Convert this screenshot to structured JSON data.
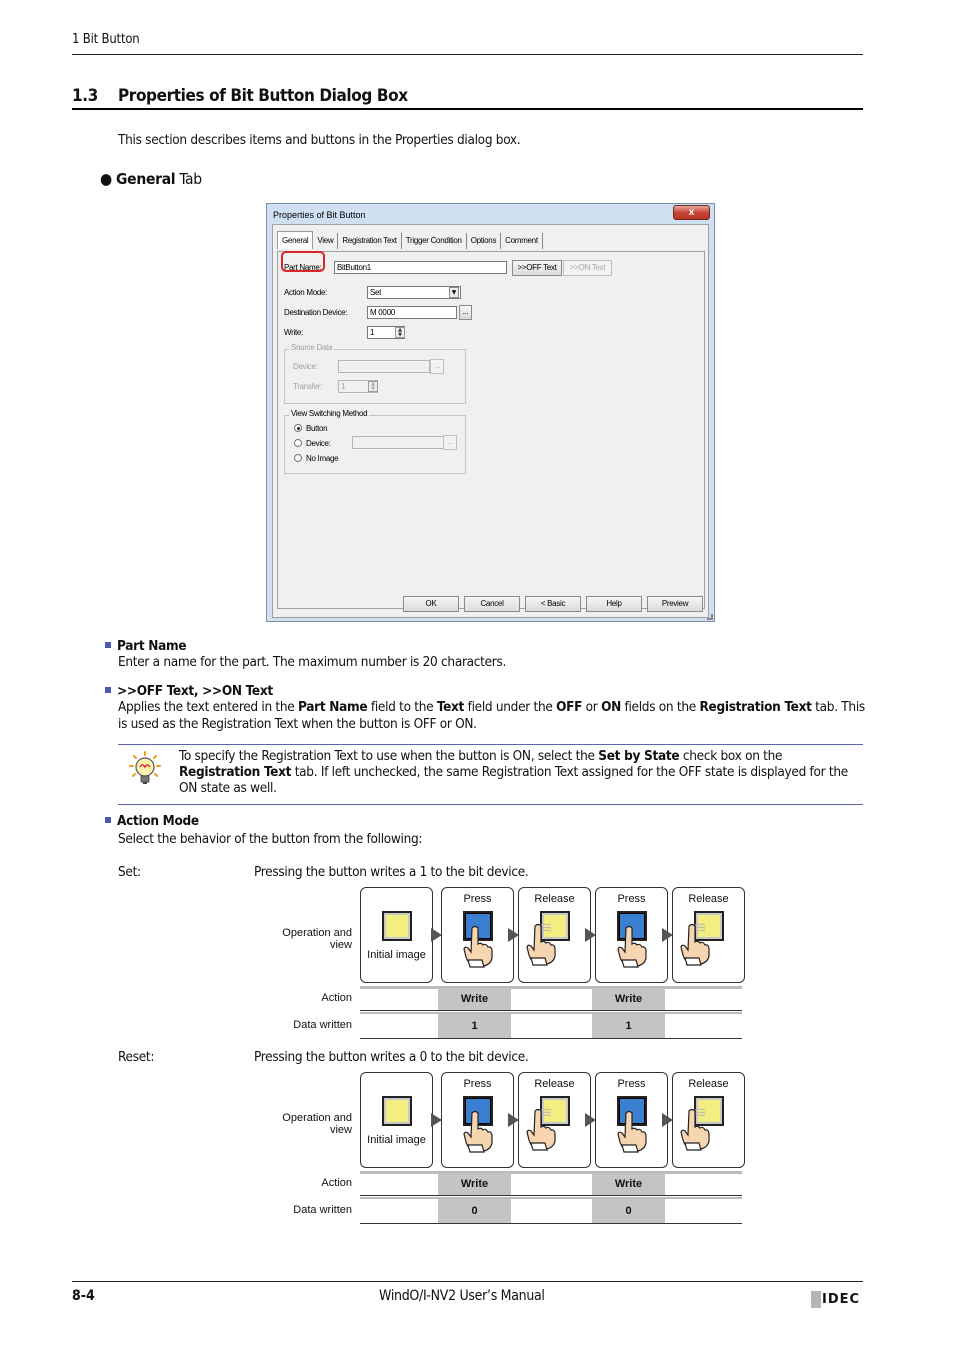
{
  "header": {
    "running_head": "1 Bit Button"
  },
  "section": {
    "number": "1.3",
    "title": "Properties of Bit Button Dialog Box",
    "intro": "This section describes items and buttons in the Properties dialog box.",
    "subhead_bold": "General",
    "subhead_rest": " Tab"
  },
  "dialog": {
    "title": "Properties of Bit Button",
    "close_glyph": "x",
    "tabs": [
      {
        "label": "General",
        "active": true
      },
      {
        "label": "View"
      },
      {
        "label": "Registration Text"
      },
      {
        "label": "Trigger Condition"
      },
      {
        "label": "Options"
      },
      {
        "label": "Comment"
      }
    ],
    "part_name_label": "Part Name:",
    "part_name_value": "BitButton1",
    "off_text_button": ">>OFF Text",
    "on_text_button": ">>ON Text",
    "action_mode_label": "Action Mode:",
    "action_mode_value": "Set",
    "destination_device_label": "Destination Device:",
    "destination_device_value": "M 0000",
    "browse_button": "...",
    "write_label": "Write:",
    "write_value": "1",
    "source_data": {
      "legend": "Source Data",
      "device_label": "Device:",
      "device_value": "",
      "transfer_label": "Transfer:",
      "transfer_value": "1"
    },
    "view_switching": {
      "legend": "View Switching Method",
      "options": [
        {
          "label": "Button",
          "selected": true
        },
        {
          "label": "Device:",
          "selected": false
        },
        {
          "label": "No Image",
          "selected": false
        }
      ],
      "device_value": ""
    },
    "footer_buttons": [
      "OK",
      "Cancel",
      "< Basic",
      "Help",
      "Preview"
    ]
  },
  "items": {
    "part_name": {
      "heading": "Part Name",
      "body": "Enter a name for the part. The maximum number is 20 characters."
    },
    "off_on_text": {
      "heading": ">>OFF Text, >>ON Text",
      "body_parts": [
        "Applies the text entered in the ",
        "Part Name",
        " field to the ",
        "Text",
        " field under the ",
        "OFF",
        " or ",
        "ON",
        " fields on the ",
        "Registration Text",
        " tab. This is used as the Registration Text when the button is OFF or ON."
      ]
    },
    "note": {
      "icon": "lightbulb-icon",
      "parts": [
        "To specify the Registration Text to use when the button is ON, select the ",
        "Set by State",
        " check box on the ",
        "Registration Text",
        " tab. If left unchecked, the same Registration Text assigned for the OFF state is displayed for the ON state as well."
      ]
    },
    "action_mode": {
      "heading": "Action Mode",
      "body": "Select the behavior of the button from the following:"
    }
  },
  "modes": [
    {
      "name": "Set:",
      "description": "Pressing the button writes a 1 to the bit device.",
      "diagram": {
        "row_labels": {
          "operation": "Operation and view",
          "action": "Action",
          "data": "Data written"
        },
        "initial_caption": "Initial image",
        "steps": [
          {
            "caption": "Press",
            "state": "on",
            "action": "Write",
            "data": "1"
          },
          {
            "caption": "Release",
            "state": "off",
            "action": "",
            "data": ""
          },
          {
            "caption": "Press",
            "state": "on",
            "action": "Write",
            "data": "1"
          },
          {
            "caption": "Release",
            "state": "off",
            "action": "",
            "data": ""
          }
        ]
      }
    },
    {
      "name": "Reset:",
      "description": "Pressing the button writes a 0 to the bit device.",
      "diagram": {
        "row_labels": {
          "operation": "Operation and view",
          "action": "Action",
          "data": "Data written"
        },
        "initial_caption": "Initial image",
        "steps": [
          {
            "caption": "Press",
            "state": "on",
            "action": "Write",
            "data": "0"
          },
          {
            "caption": "Release",
            "state": "off",
            "action": "",
            "data": ""
          },
          {
            "caption": "Press",
            "state": "on",
            "action": "Write",
            "data": "0"
          },
          {
            "caption": "Release",
            "state": "off",
            "action": "",
            "data": ""
          }
        ]
      }
    }
  ],
  "footer": {
    "page_number": "8-4",
    "manual_title": "WindO/I-NV2 User’s Manual",
    "logo_text": "IDEC"
  },
  "colors": {
    "tab_highlight": "#d9262b",
    "bullet": "#4a5aa8",
    "button_off": "#f2ef80",
    "button_on": "#3a7fd0",
    "table_cell": "#c4c4c4"
  }
}
